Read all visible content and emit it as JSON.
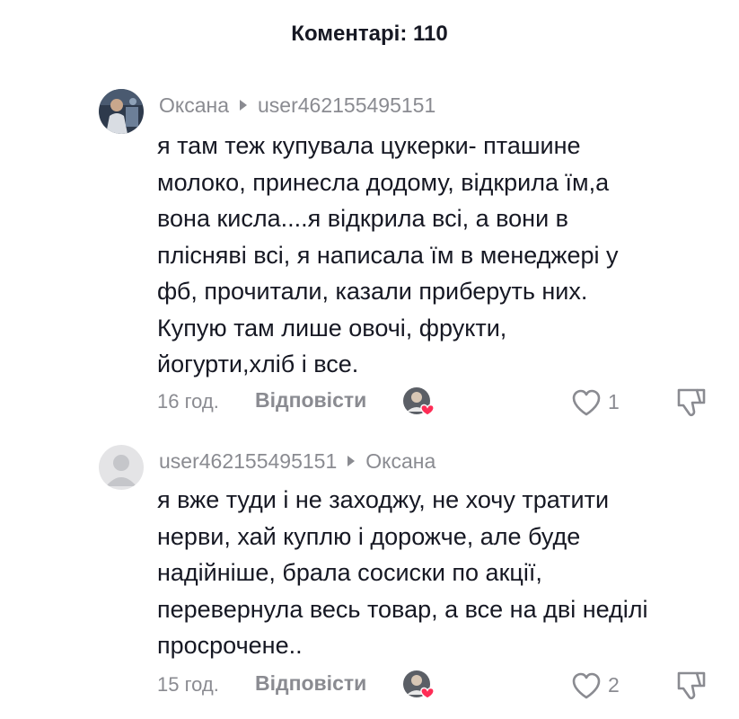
{
  "header": {
    "title": "Коментарі: 110"
  },
  "comments": [
    {
      "author": "Оксана",
      "reply_to": "user462155495151",
      "text_lines": [
        "я там теж купувала цукерки- пташине",
        "молоко, принесла додому, відкрила їм,а",
        "вона кисла....я відкрила всі, а вони в",
        "плісняві всі, я написала їм в менеджері у",
        "фб, прочитали, казали приберуть них.",
        "Купую там лише овочі, фрукти,",
        "йогурти,хліб і все."
      ],
      "time": "16 год.",
      "reply_label": "Відповісти",
      "likes": "1",
      "avatar_icon": "user-photo-avatar",
      "creator_like_icon": "creator-liked-heart-avatar"
    },
    {
      "author": "user462155495151",
      "reply_to": "Оксана",
      "text_lines": [
        "я вже туди і не заходжу, не хочу тратити",
        "нерви, хай куплю і дорожче, але буде",
        "надійніше, брала сосиски по акції,",
        "перевернула весь товар, а все на дві неділі",
        "просрочене.."
      ],
      "time": "15 год.",
      "reply_label": "Відповісти",
      "likes": "2",
      "avatar_icon": "default-avatar",
      "creator_like_icon": "creator-liked-heart-avatar"
    }
  ],
  "colors": {
    "text": "#161823",
    "muted": "#8a8b91",
    "heart": "#fe2c55"
  }
}
